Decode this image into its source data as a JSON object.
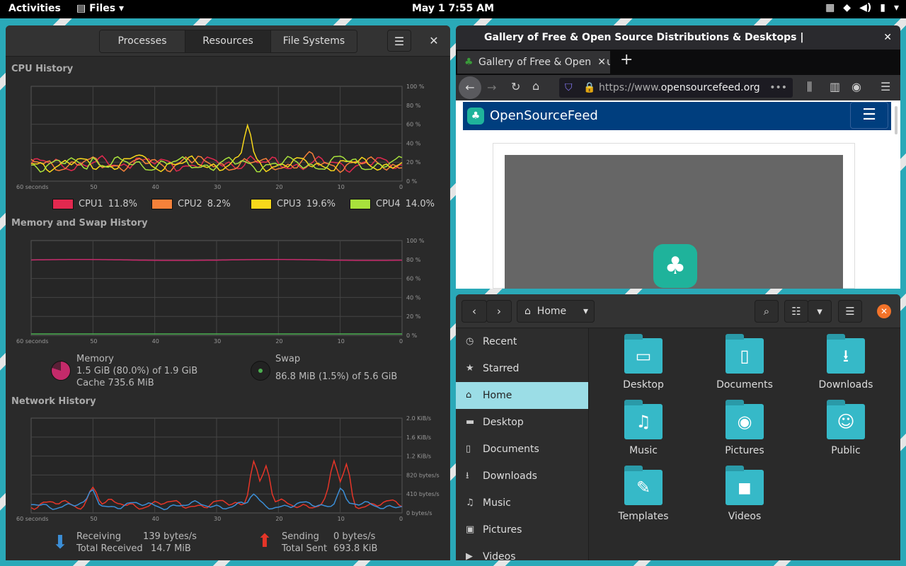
{
  "topbar": {
    "activities": "Activities",
    "app": "Files",
    "clock": "May 1  7:55 AM"
  },
  "sysmon": {
    "tabs": [
      "Processes",
      "Resources",
      "File Systems"
    ],
    "cpu": {
      "title": "CPU History",
      "ticks_y": [
        "100 %",
        "80 %",
        "60 %",
        "40 %",
        "20 %",
        "0 %"
      ],
      "ticks_x": [
        "60 seconds",
        "50",
        "40",
        "30",
        "20",
        "10",
        "0"
      ],
      "legend": [
        {
          "name": "CPU1",
          "value": "11.8%",
          "color": "#e2294f"
        },
        {
          "name": "CPU2",
          "value": "8.2%",
          "color": "#f5813a"
        },
        {
          "name": "CPU3",
          "value": "19.6%",
          "color": "#f8d81b"
        },
        {
          "name": "CPU4",
          "value": "14.0%",
          "color": "#a8e23c"
        }
      ]
    },
    "mem": {
      "title": "Memory and Swap History",
      "mem_label": "Memory",
      "mem_used": "1.5 GiB (80.0%) of 1.9 GiB",
      "mem_cache": "Cache 735.6 MiB",
      "swap_label": "Swap",
      "swap_used": "86.8 MiB (1.5%) of 5.6 GiB"
    },
    "net": {
      "title": "Network History",
      "ticks_y": [
        "2.0 KiB/s",
        "1.6 KiB/s",
        "1.2 KiB/s",
        "820 bytes/s",
        "410 bytes/s",
        "0 bytes/s"
      ],
      "recv_label": "Receiving",
      "recv": "139 bytes/s",
      "total_recv_label": "Total Received",
      "total_recv": "14.7 MiB",
      "send_label": "Sending",
      "send": "0 bytes/s",
      "total_sent_label": "Total Sent",
      "total_sent": "693.8 KiB"
    }
  },
  "firefox": {
    "title": "Gallery of Free & Open Source Distributions & Desktops | OpenSourceFeed - Mozilla Firefox",
    "tab": "Gallery of Free & Open Sou",
    "url_prefix": "https://www.",
    "url_domain": "opensourcefeed.org",
    "site_name": "OpenSourceFeed"
  },
  "files": {
    "location": "Home",
    "sidebar": [
      "Recent",
      "Starred",
      "Home",
      "Desktop",
      "Documents",
      "Downloads",
      "Music",
      "Pictures",
      "Videos"
    ],
    "folders": [
      "Desktop",
      "Documents",
      "Downloads",
      "Music",
      "Pictures",
      "Public",
      "Templates",
      "Videos"
    ]
  }
}
